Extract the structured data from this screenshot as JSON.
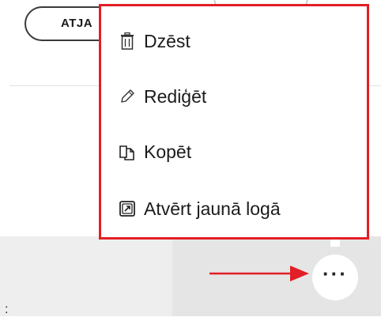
{
  "toolbar": {
    "refresh_label": "ATJA"
  },
  "context_menu": {
    "items": [
      {
        "label": "Dzēst",
        "icon": "trash-icon"
      },
      {
        "label": "Rediģēt",
        "icon": "pencil-icon"
      },
      {
        "label": "Kopēt",
        "icon": "copy-icon"
      },
      {
        "label": "Atvērt jaunā logā",
        "icon": "open-new-window-icon"
      }
    ]
  },
  "more_button": {
    "label": "···",
    "icon": "more-horizontal-icon"
  },
  "annotations": {
    "highlight_color": "#e21e26",
    "arrow_color": "#e21e26"
  },
  "footer_mark": ":"
}
